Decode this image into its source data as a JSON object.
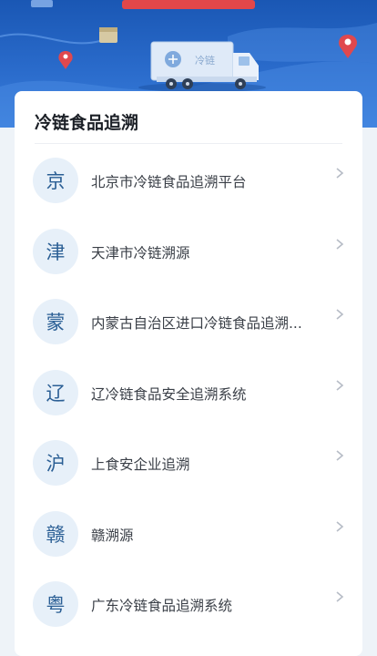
{
  "header": {
    "truck_text": "冷链"
  },
  "card": {
    "title": "冷链食品追溯"
  },
  "items": [
    {
      "abbr": "京",
      "label": "北京市冷链食品追溯平台"
    },
    {
      "abbr": "津",
      "label": "天津市冷链溯源"
    },
    {
      "abbr": "蒙",
      "label": "内蒙古自治区进口冷链食品追溯..."
    },
    {
      "abbr": "辽",
      "label": "辽冷链食品安全追溯系统"
    },
    {
      "abbr": "沪",
      "label": "上食安企业追溯"
    },
    {
      "abbr": "赣",
      "label": "赣溯源"
    },
    {
      "abbr": "粤",
      "label": "广东冷链食品追溯系统"
    }
  ],
  "icons": {
    "item_arrow": "chevron-right-icon"
  },
  "colors": {
    "header_blue": "#1f5fbf",
    "avatar_bg": "#e7f0f9",
    "avatar_text": "#2b5f95",
    "title_text": "#1b1f26",
    "map_pin_red": "#e0484e"
  }
}
